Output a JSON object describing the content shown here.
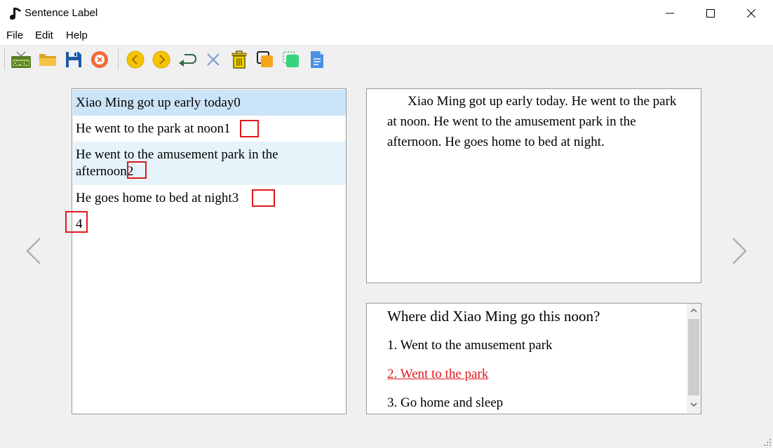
{
  "window": {
    "title": "Sentence Label",
    "controls": [
      "minimize",
      "maximize",
      "close"
    ]
  },
  "menu": [
    "File",
    "Edit",
    "Help"
  ],
  "toolbar": {
    "open_icon_label": "OPEN",
    "buttons": [
      {
        "name": "open-file",
        "icon": "open-sign-icon"
      },
      {
        "name": "open-folder",
        "icon": "folder-icon"
      },
      {
        "name": "save",
        "icon": "floppy-disk-icon"
      },
      {
        "name": "close-file",
        "icon": "close-circle-icon"
      },
      {
        "name": "previous",
        "icon": "chevron-left-circle-icon"
      },
      {
        "name": "next",
        "icon": "chevron-right-circle-icon"
      },
      {
        "name": "undo",
        "icon": "return-arrow-icon"
      },
      {
        "name": "delete",
        "icon": "cross-icon"
      },
      {
        "name": "clear",
        "icon": "trash-icon"
      },
      {
        "name": "copy",
        "icon": "copy-icon"
      },
      {
        "name": "select",
        "icon": "select-icon"
      },
      {
        "name": "document",
        "icon": "document-icon"
      }
    ]
  },
  "sentences": [
    {
      "text": "Xiao Ming got up early today",
      "index": "0",
      "selected": true
    },
    {
      "text": " He went to the park at noon",
      "index": "1"
    },
    {
      "text_line1": " He went to the amusement park in the",
      "text_line2": "afternoon",
      "index": "2"
    },
    {
      "text": " He goes home to bed at night",
      "index": "3"
    },
    {
      "text": "",
      "index": "4"
    }
  ],
  "passage": "Xiao Ming got up early today. He went to the park at noon. He went to the amusement park in the afternoon. He goes home to bed at night.",
  "question": {
    "title": "Where did Xiao Ming go this noon?",
    "options": [
      {
        "label": "1. Went to the amusement park",
        "selected": false
      },
      {
        "label": "2. Went to the park",
        "selected": true
      },
      {
        "label": "3. Go home and sleep",
        "selected": false
      }
    ]
  },
  "colors": {
    "selected_row": "#cce4f7",
    "hover_row": "#e5f3fb",
    "highlight_box": "#e0171c",
    "selected_option": "#e0171c",
    "background": "#f0f0f0"
  }
}
